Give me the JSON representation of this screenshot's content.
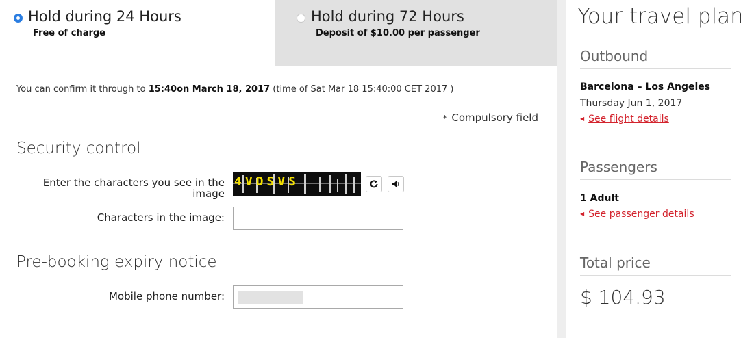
{
  "hold_options": [
    {
      "title": "Hold during 24 Hours",
      "subtitle": "Free of charge",
      "selected": true
    },
    {
      "title": "Hold during 72 Hours",
      "subtitle": "Deposit of $10.00 per passenger",
      "selected": false
    }
  ],
  "confirm": {
    "prefix": "You can confirm it through to ",
    "deadline": "15:40on March 18, 2017",
    "suffix": " (time of Sat Mar 18 15:40:00 CET 2017 )"
  },
  "compulsory": {
    "star": "*",
    "label": "Compulsory field"
  },
  "security": {
    "heading": "Security control",
    "captcha_label": "Enter the characters you see in the image",
    "captcha_text": "4VDSVS",
    "refresh_icon": "refresh-icon",
    "audio_icon": "speaker-icon",
    "chars_label": "Characters in the image:",
    "chars_value": ""
  },
  "prebooking": {
    "heading": "Pre-booking expiry notice",
    "mobile_label": "Mobile phone number:"
  },
  "sidebar": {
    "title": "Your travel plan",
    "outbound": {
      "heading": "Outbound",
      "route": "Barcelona – Los Angeles",
      "date": "Thursday Jun 1, 2017",
      "link": "See flight details"
    },
    "passengers": {
      "heading": "Passengers",
      "count": "1 Adult",
      "link": "See passenger details"
    },
    "total": {
      "heading": "Total price",
      "amount": "$ 104.93"
    }
  },
  "colors": {
    "accent": "#2a7de1",
    "link": "#d3232d",
    "option_inactive_bg": "#e1e1e1"
  }
}
